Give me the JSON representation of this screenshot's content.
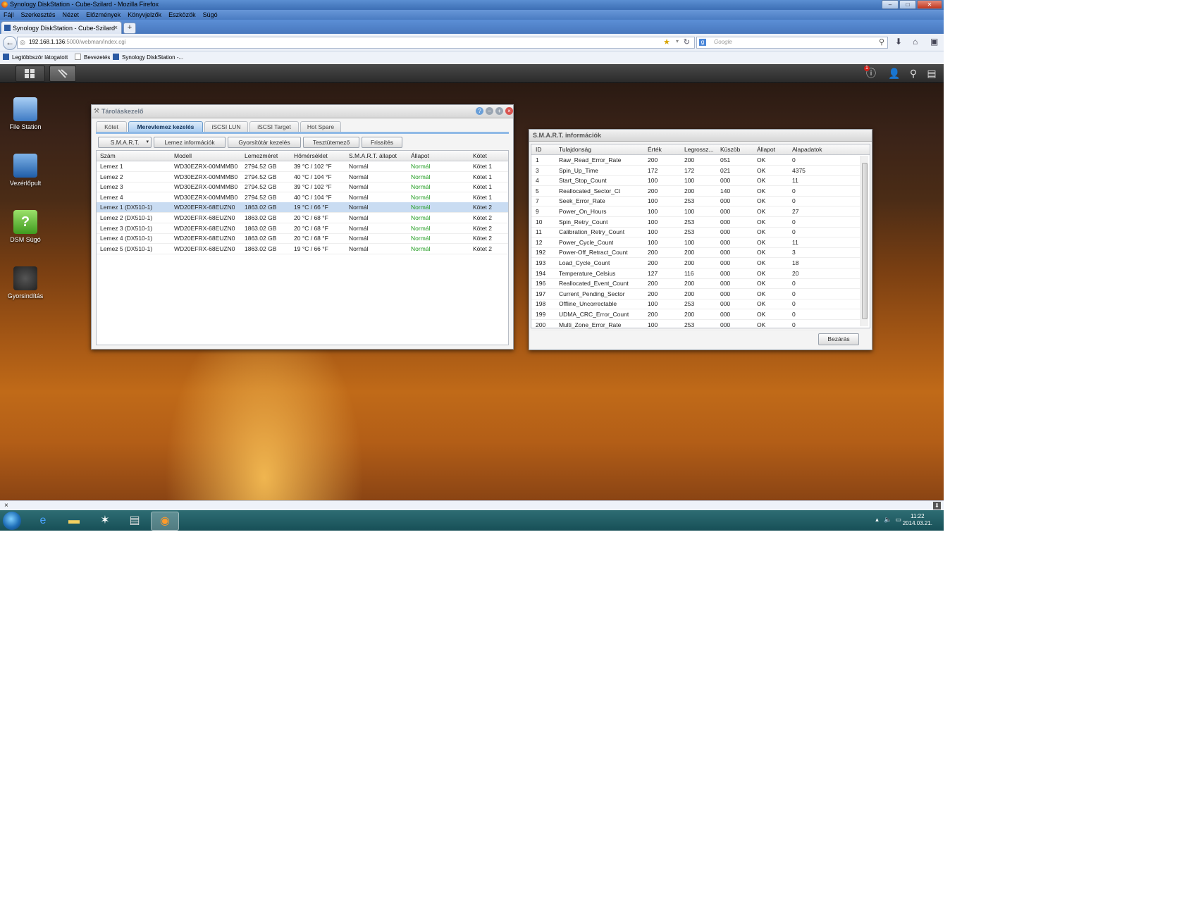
{
  "browser": {
    "window_title": "Synology DiskStation - Cube-Szilard - Mozilla Firefox",
    "menu": [
      "Fájl",
      "Szerkesztés",
      "Nézet",
      "Előzmények",
      "Könyvjelzők",
      "Eszközök",
      "Súgó"
    ],
    "tab_title": "Synology DiskStation - Cube-Szilard",
    "new_tab": "+",
    "url_host": "192.168.1.136",
    "url_rest": ":5000/webman/index.cgi",
    "search_placeholder": "Google",
    "bookmarks": [
      "Legtöbbször látogatott",
      "Bevezetés",
      "Synology DiskStation -..."
    ]
  },
  "dsm": {
    "notification_count": "1",
    "desktop_icons": [
      "File Station",
      "Vezérlőpult",
      "DSM Súgó",
      "Gyorsindítás"
    ]
  },
  "storage_manager": {
    "title": "Tároláskezelő",
    "tabs": [
      "Kötet",
      "Merevlemez kezelés",
      "iSCSI LUN",
      "iSCSI Target",
      "Hot Spare"
    ],
    "active_tab": "Merevlemez kezelés",
    "toolbar": [
      "S.M.A.R.T.",
      "Lemez információk",
      "Gyorsítótár kezelés",
      "Tesztütemező",
      "Frissítés"
    ],
    "columns": [
      "Szám",
      "Modell",
      "Lemezméret",
      "Hőmérséklet",
      "S.M.A.R.T. állapot",
      "Állapot",
      "Kötet"
    ],
    "rows": [
      [
        "Lemez 1",
        "WD30EZRX-00MMMB0",
        "2794.52 GB",
        "39 °C / 102 °F",
        "Normál",
        "Normál",
        "Kötet 1"
      ],
      [
        "Lemez 2",
        "WD30EZRX-00MMMB0",
        "2794.52 GB",
        "40 °C / 104 °F",
        "Normál",
        "Normál",
        "Kötet 1"
      ],
      [
        "Lemez 3",
        "WD30EZRX-00MMMB0",
        "2794.52 GB",
        "39 °C / 102 °F",
        "Normál",
        "Normál",
        "Kötet 1"
      ],
      [
        "Lemez 4",
        "WD30EZRX-00MMMB0",
        "2794.52 GB",
        "40 °C / 104 °F",
        "Normál",
        "Normál",
        "Kötet 1"
      ],
      [
        "Lemez 1 (DX510-1)",
        "WD20EFRX-68EUZN0",
        "1863.02 GB",
        "19 °C / 66 °F",
        "Normál",
        "Normál",
        "Kötet 2"
      ],
      [
        "Lemez 2 (DX510-1)",
        "WD20EFRX-68EUZN0",
        "1863.02 GB",
        "20 °C / 68 °F",
        "Normál",
        "Normál",
        "Kötet 2"
      ],
      [
        "Lemez 3 (DX510-1)",
        "WD20EFRX-68EUZN0",
        "1863.02 GB",
        "20 °C / 68 °F",
        "Normál",
        "Normál",
        "Kötet 2"
      ],
      [
        "Lemez 4 (DX510-1)",
        "WD20EFRX-68EUZN0",
        "1863.02 GB",
        "20 °C / 68 °F",
        "Normál",
        "Normál",
        "Kötet 2"
      ],
      [
        "Lemez 5 (DX510-1)",
        "WD20EFRX-68EUZN0",
        "1863.02 GB",
        "19 °C / 66 °F",
        "Normál",
        "Normál",
        "Kötet 2"
      ]
    ],
    "selected_row": 4
  },
  "smart": {
    "title": "S.M.A.R.T. információk",
    "columns": [
      "ID",
      "Tulajdonság",
      "Érték",
      "Legrossz...",
      "Küszöb",
      "Állapot",
      "Alapadatok"
    ],
    "rows": [
      [
        "1",
        "Raw_Read_Error_Rate",
        "200",
        "200",
        "051",
        "OK",
        "0"
      ],
      [
        "3",
        "Spin_Up_Time",
        "172",
        "172",
        "021",
        "OK",
        "4375"
      ],
      [
        "4",
        "Start_Stop_Count",
        "100",
        "100",
        "000",
        "OK",
        "11"
      ],
      [
        "5",
        "Reallocated_Sector_Ct",
        "200",
        "200",
        "140",
        "OK",
        "0"
      ],
      [
        "7",
        "Seek_Error_Rate",
        "100",
        "253",
        "000",
        "OK",
        "0"
      ],
      [
        "9",
        "Power_On_Hours",
        "100",
        "100",
        "000",
        "OK",
        "27"
      ],
      [
        "10",
        "Spin_Retry_Count",
        "100",
        "253",
        "000",
        "OK",
        "0"
      ],
      [
        "11",
        "Calibration_Retry_Count",
        "100",
        "253",
        "000",
        "OK",
        "0"
      ],
      [
        "12",
        "Power_Cycle_Count",
        "100",
        "100",
        "000",
        "OK",
        "11"
      ],
      [
        "192",
        "Power-Off_Retract_Count",
        "200",
        "200",
        "000",
        "OK",
        "3"
      ],
      [
        "193",
        "Load_Cycle_Count",
        "200",
        "200",
        "000",
        "OK",
        "18"
      ],
      [
        "194",
        "Temperature_Celsius",
        "127",
        "116",
        "000",
        "OK",
        "20"
      ],
      [
        "196",
        "Reallocated_Event_Count",
        "200",
        "200",
        "000",
        "OK",
        "0"
      ],
      [
        "197",
        "Current_Pending_Sector",
        "200",
        "200",
        "000",
        "OK",
        "0"
      ],
      [
        "198",
        "Offline_Uncorrectable",
        "100",
        "253",
        "000",
        "OK",
        "0"
      ],
      [
        "199",
        "UDMA_CRC_Error_Count",
        "200",
        "200",
        "000",
        "OK",
        "0"
      ],
      [
        "200",
        "Multi_Zone_Error_Rate",
        "100",
        "253",
        "000",
        "OK",
        "0"
      ]
    ],
    "close_label": "Bezárás"
  },
  "taskbar": {
    "time": "11:22",
    "date": "2014.03.21."
  }
}
